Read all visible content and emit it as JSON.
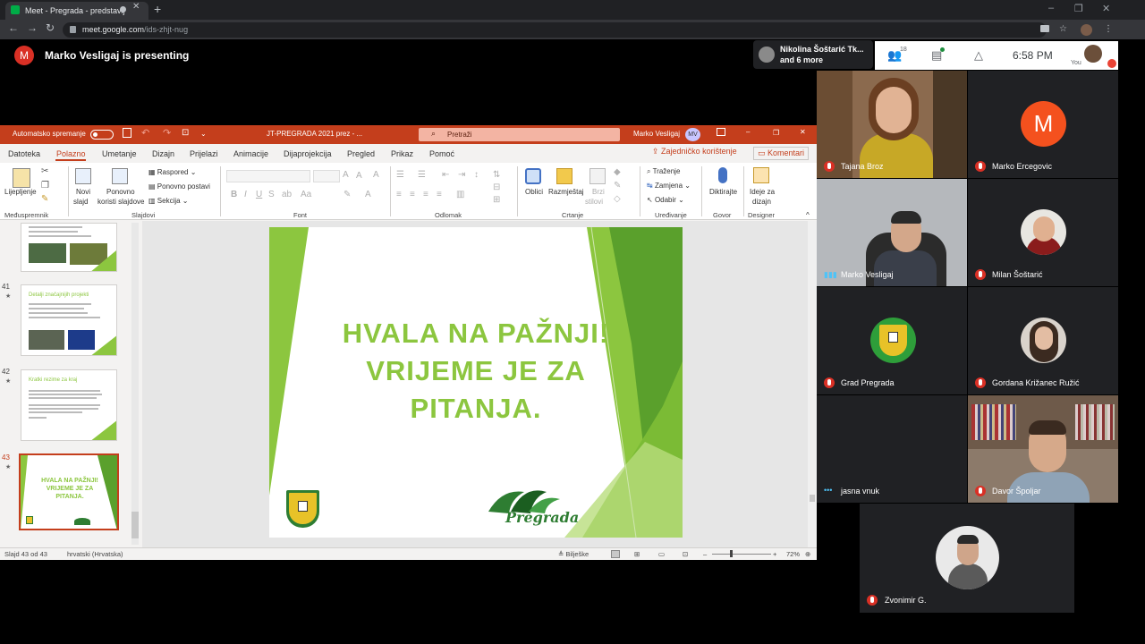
{
  "browser": {
    "tab_title": "Meet - Pregrada - predstavlj",
    "new_tab": "+",
    "url_main": "meet.google.com",
    "url_rest": "/ids-zhjt-nug",
    "back": "←",
    "forward": "→",
    "reload": "↻",
    "star": "☆",
    "menu": "⋮",
    "minimize": "–",
    "maximize": "❐",
    "close": "✕",
    "tab_close": "✕"
  },
  "meet": {
    "presenter_initial": "M",
    "presenting_text": "Marko Vesligaj is presenting",
    "notification_line1": "Nikolina Šoštarić Tk...",
    "notification_line2": "and 6 more",
    "people_count": "18",
    "clock": "6:58 PM",
    "you_label": "You",
    "icon_people": "👥",
    "icon_chat": "▤",
    "icon_activities": "△"
  },
  "ppt": {
    "autosave": "Automatsko spremanje",
    "filename": "JT-PREGRADA 2021 prez - ...",
    "search": "Pretraži",
    "user": "Marko Vesligaj",
    "user_initials": "MV",
    "menu": [
      "Datoteka",
      "Polazno",
      "Umetanje",
      "Dizajn",
      "Prijelazi",
      "Animacije",
      "Dijaprojekcija",
      "Pregled",
      "Prikaz",
      "Pomoć"
    ],
    "share": "Zajedničko korištenje",
    "comments": "Komentari",
    "ribbon": {
      "paste": "Lijepljenje",
      "new_slide_1": "Novi",
      "new_slide_2": "slajd",
      "reuse_1": "Ponovno",
      "reuse_2": "koristi slajdove",
      "layout": "Raspored",
      "reset": "Ponovno postavi",
      "section": "Sekcija",
      "shapes": "Oblici",
      "arrange": "Razmještaj",
      "quick_1": "Brzi",
      "quick_2": "stilovi",
      "find": "Traženje",
      "replace": "Zamjena",
      "select": "Odabir",
      "dictate": "Diktirajte",
      "ideas_1": "Ideje za",
      "ideas_2": "dizajn",
      "groups": [
        "Međuspremnik",
        "Slajdovi",
        "Font",
        "Odlomak",
        "Crtanje",
        "Uređivanje",
        "Govor",
        "Designer"
      ]
    },
    "thumbnails": [
      {
        "num": "41",
        "title": "Detalji značajnijih projekti"
      },
      {
        "num": "42",
        "title": "Kratki rezime za kraj"
      },
      {
        "num": "43",
        "title": "HVALA NA PAŽNJI! VRIJEME JE ZA PITANJA."
      }
    ],
    "slide": {
      "line1": "HVALA NA PAŽNJI!",
      "line2": "VRIJEME JE ZA",
      "line3": "PITANJA.",
      "logo_text": "Pregrada"
    },
    "status": {
      "slide_count": "Slajd 43 od 43",
      "language": "hrvatski (Hrvatska)",
      "notes": "Bilješke",
      "zoom": "72%"
    }
  },
  "participants": [
    {
      "name": "Tajana Broz"
    },
    {
      "name": "Marko Ercegovic",
      "initial": "M"
    },
    {
      "name": "Marko Vesligaj"
    },
    {
      "name": "Milan Šoštarić"
    },
    {
      "name": "Grad Pregrada"
    },
    {
      "name": "Gordana Križanec Ružić"
    },
    {
      "name": "jasna vnuk"
    },
    {
      "name": "Davor Špoljar"
    },
    {
      "name": "Zvonimir G."
    }
  ],
  "colors": {
    "ppt_accent": "#c43e1c",
    "slide_green": "#8cc63f",
    "meet_red": "#d93025",
    "dark_green": "#2e7d32"
  }
}
